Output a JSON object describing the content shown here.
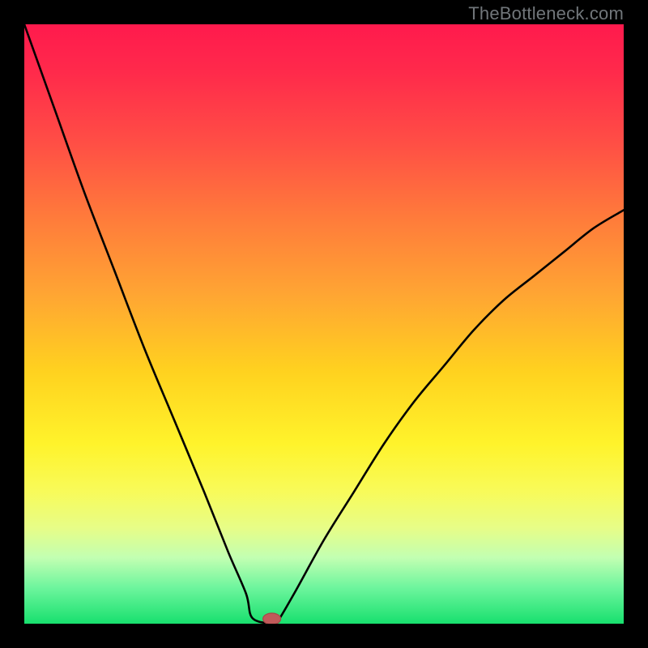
{
  "watermark": "TheBottleneck.com",
  "colors": {
    "frame": "#000000",
    "curve": "#000000",
    "marker_fill": "#c05a5a",
    "marker_stroke": "#a84848"
  },
  "chart_data": {
    "type": "line",
    "title": "",
    "xlabel": "",
    "ylabel": "",
    "xlim": [
      0,
      100
    ],
    "ylim": [
      0,
      100
    ],
    "grid": false,
    "legend": false,
    "series": [
      {
        "name": "bottleneck-curve",
        "x": [
          0,
          5,
          10,
          15,
          20,
          25,
          30,
          34,
          37,
          38,
          41,
          42,
          45,
          50,
          55,
          60,
          65,
          70,
          75,
          80,
          85,
          90,
          95,
          100
        ],
        "values": [
          100,
          86,
          72,
          59,
          46,
          34,
          22,
          12,
          5,
          1,
          0,
          0,
          5,
          14,
          22,
          30,
          37,
          43,
          49,
          54,
          58,
          62,
          66,
          69
        ]
      }
    ],
    "marker": {
      "name": "optimal-point",
      "x": 41.3,
      "y": 0
    }
  }
}
